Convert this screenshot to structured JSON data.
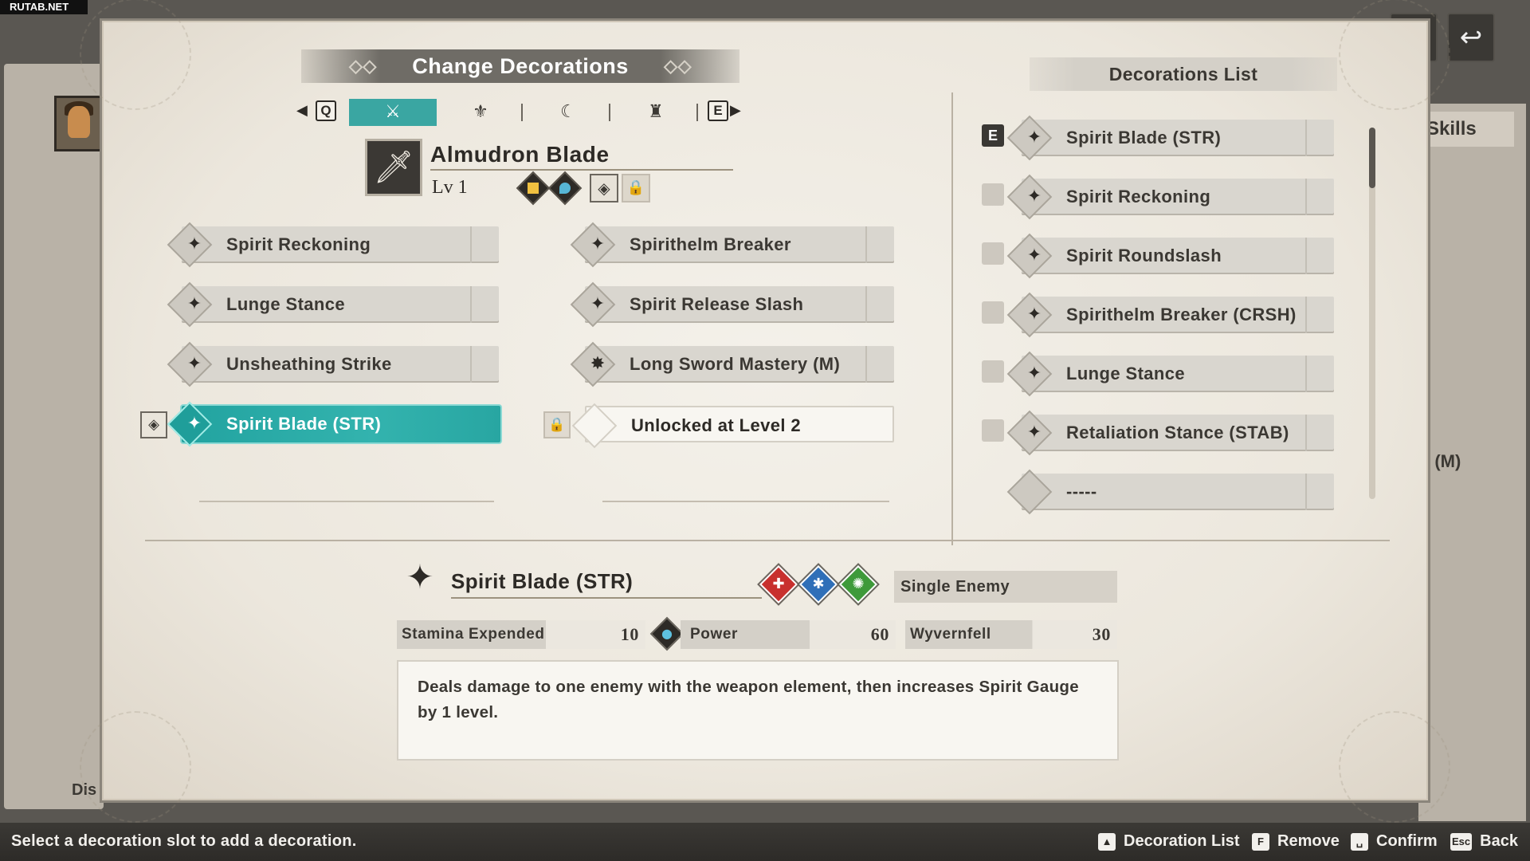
{
  "watermark": "RUTAB.NET",
  "background": {
    "skills_tab": "Skills",
    "partial_right": "y (M)",
    "partial_bottom_left": "Dis"
  },
  "header": {
    "title": "Change Decorations",
    "tab_keys": {
      "left": "Q",
      "right": "E"
    },
    "tabs": [
      {
        "icon": "weapon-tab-icon",
        "active": true
      },
      {
        "icon": "head-armor-tab-icon",
        "active": false
      },
      {
        "icon": "arm-armor-tab-icon",
        "active": false
      },
      {
        "icon": "body-armor-tab-icon",
        "active": false
      }
    ]
  },
  "weapon": {
    "name": "Almudron Blade",
    "level": "Lv 1",
    "slots": [
      "thunder-slot",
      "water-slot"
    ]
  },
  "skills_left": [
    {
      "label": "Spirit Reckoning",
      "icon": "spirit-blade-icon"
    },
    {
      "label": "Lunge Stance",
      "icon": "spirit-blade-icon"
    },
    {
      "label": "Unsheathing Strike",
      "icon": "spirit-blade-icon"
    },
    {
      "label": "Spirit Blade (STR)",
      "icon": "spirit-blade-icon",
      "active": true
    }
  ],
  "skills_right": [
    {
      "label": "Spirithelm Breaker",
      "icon": "spirit-blade-icon"
    },
    {
      "label": "Spirit Release Slash",
      "icon": "spirit-blade-icon"
    },
    {
      "label": "Long Sword Mastery (M)",
      "icon": "mastery-icon"
    },
    {
      "label": "Unlocked at Level 2",
      "locked": true
    }
  ],
  "decorations_list": {
    "title": "Decorations List",
    "equipped_marker": "E",
    "items": [
      {
        "label": "Spirit Blade (STR)",
        "equipped": true
      },
      {
        "label": "Spirit Reckoning",
        "equipped": false
      },
      {
        "label": "Spirit Roundslash",
        "equipped": false
      },
      {
        "label": "Spirithelm Breaker (CRSH)",
        "equipped": false
      },
      {
        "label": "Lunge Stance",
        "equipped": false
      },
      {
        "label": "Retaliation Stance (STAB)",
        "equipped": false
      },
      {
        "label": "-----",
        "equipped": false,
        "empty": true
      }
    ]
  },
  "detail": {
    "title": "Spirit Blade (STR)",
    "elements": [
      {
        "name": "strength",
        "color": "#c8302e"
      },
      {
        "name": "technique",
        "color": "#2f6fb8"
      },
      {
        "name": "speed",
        "color": "#3e9a3a"
      }
    ],
    "target": "Single Enemy",
    "stats": [
      {
        "label": "Stamina Expended",
        "value": "10"
      },
      {
        "label": "Power",
        "value": "60"
      },
      {
        "label": "Wyvernfell",
        "value": "30"
      }
    ],
    "description": "Deals damage to one enemy with the weapon element, then increases Spirit Gauge by 1 level."
  },
  "bottom_bar": {
    "hint": "Select a decoration slot to add a decoration.",
    "controls": [
      {
        "key": "▲",
        "label": "Decoration List"
      },
      {
        "key": "F",
        "label": "Remove"
      },
      {
        "key": "␣",
        "label": "Confirm"
      },
      {
        "key": "Esc",
        "label": "Back"
      }
    ]
  },
  "colors": {
    "accent": "#33b3ae",
    "parchment": "#ece7dd",
    "text": "#2d2a26"
  }
}
